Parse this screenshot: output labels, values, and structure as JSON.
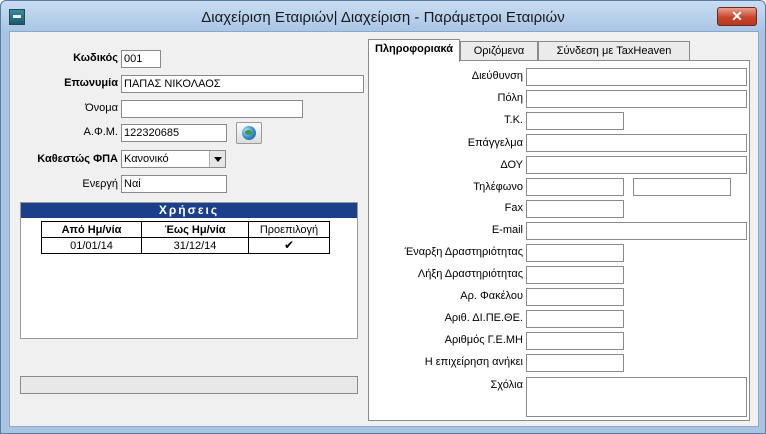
{
  "window": {
    "title": "Διαχείριση Εταιριών| Διαχείριση - Παράμετροι Εταιριών",
    "close_glyph": "✕"
  },
  "company": {
    "code_label": "Κωδικός",
    "code_value": "001",
    "name_label": "Επωνυμία",
    "name_value": "ΠΑΠΑΣ ΝΙΚΟΛΑΟΣ",
    "firstname_label": "Όνομα",
    "firstname_value": "",
    "afm_label": "Α.Φ.Μ.",
    "afm_value": "122320685",
    "vat_label": "Καθεστώς ΦΠΑ",
    "vat_value": "Κανονικό",
    "active_label": "Ενεργή",
    "active_value": "Ναί"
  },
  "years": {
    "title": "Χρήσεις",
    "columns": [
      "Από Ημ/νία",
      "Έως Ημ/νία",
      "Προεπιλογή"
    ],
    "rows": [
      {
        "from": "01/01/14",
        "to": "31/12/14",
        "default": "✔"
      }
    ]
  },
  "tabs": [
    "Πληροφοριακά",
    "Οριζόμενα",
    "Σύνδεση με TaxHeaven"
  ],
  "info": {
    "address_label": "Διεύθυνση",
    "city_label": "Πόλη",
    "zip_label": "Τ.Κ.",
    "profession_label": "Επάγγελμα",
    "doy_label": "ΔΟΥ",
    "phone_label": "Τηλέφωνο",
    "fax_label": "Fax",
    "email_label": "E-mail",
    "start_label": "Έναρξη Δραστηριότητας",
    "end_label": "Λήξη Δραστηριότητας",
    "folder_label": "Αρ. Φακέλου",
    "dipethe_label": "Αριθ. ΔΙ.ΠΕ.ΘΕ.",
    "gemi_label": "Αριθμός Γ.Ε.ΜΗ",
    "belongs_label": "Η επιχείρηση ανήκει",
    "comments_label": "Σχόλια"
  }
}
